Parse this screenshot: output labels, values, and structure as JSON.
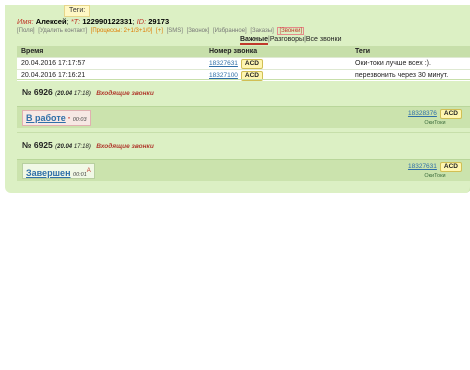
{
  "tags_tip": "Теги:",
  "client": {
    "name_label": "Имя:",
    "name": "Алексей",
    "phone_label": "*Т:",
    "phone": "122990122331",
    "id_label": "ID:",
    "id": "29173"
  },
  "actions": [
    {
      "label": "[Поля]",
      "style": "gray"
    },
    {
      "label": "[Удалить контакт]",
      "style": "gray"
    },
    {
      "label": "[Процессы: 2+1/3+1/0]",
      "style": "orange"
    },
    {
      "label": "[+]",
      "style": "orange"
    },
    {
      "label": "[SMS]",
      "style": "gray"
    },
    {
      "label": "[Звонок]",
      "style": "gray"
    },
    {
      "label": "[Избранное]",
      "style": "gray"
    },
    {
      "label": "[Заказы]",
      "style": "gray"
    },
    {
      "label": "[Звонки]",
      "style": "red"
    }
  ],
  "subtabs": {
    "active": "Важные",
    "sep1": "|",
    "tab2": "Разговоры",
    "sep2": "|",
    "tab3": "Все звонки"
  },
  "table": {
    "headers": {
      "time": "Время",
      "number": "Номер звонка",
      "tags": "Теги"
    },
    "rows": [
      {
        "time": "20.04.2016 17:17:57",
        "number": "18327631",
        "acd": "ACD",
        "tags": "Оки-токи лучше всех :)."
      },
      {
        "time": "20.04.2016 17:16:21",
        "number": "18327100",
        "acd": "ACD",
        "tags": "перезвонить через 30 минут."
      }
    ]
  },
  "deals": [
    {
      "title": "№ 6926",
      "date": "20.04",
      "time": "17:18",
      "direction": "Входящие звонки",
      "status": "В работе",
      "status_time": "00:03",
      "phone": "18328376",
      "acd": "ACD",
      "operator": "ОкиТоки"
    },
    {
      "title": "№ 6925",
      "date": "20.04",
      "time": "17:18",
      "direction": "Входящие звонки",
      "status": "Завершен",
      "status_time": "00:01",
      "mark": "A",
      "phone": "18327631",
      "acd": "ACD",
      "operator": "ОкиТоки"
    }
  ]
}
